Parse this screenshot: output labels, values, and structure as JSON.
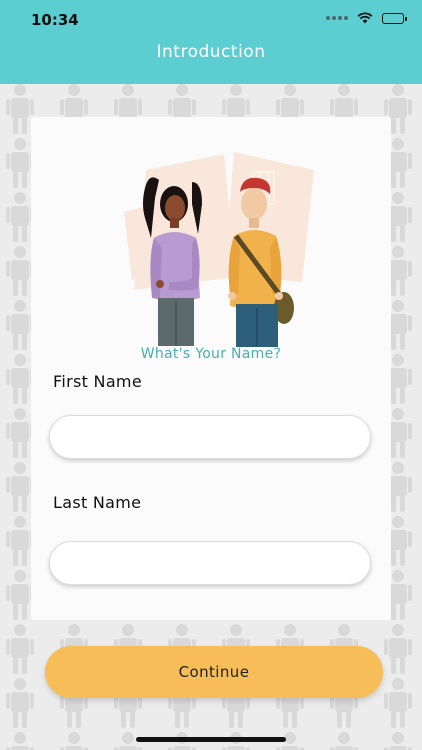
{
  "status_bar": {
    "time": "10:34",
    "icons": [
      "cellular-dots-icon",
      "wifi-icon",
      "battery-icon"
    ]
  },
  "header": {
    "title": "Introduction",
    "background": "#5ccdd1"
  },
  "card": {
    "question": "What's Your Name?",
    "first_name": {
      "label": "First Name",
      "value": "",
      "placeholder": ""
    },
    "last_name": {
      "label": "Last Name",
      "value": "",
      "placeholder": ""
    }
  },
  "footer": {
    "continue_label": "Continue",
    "accent": "#f6bd58"
  },
  "colors": {
    "header": "#5ccdd1",
    "question_text": "#4aaeb0",
    "button": "#f6bd58",
    "background": "#ececec"
  }
}
